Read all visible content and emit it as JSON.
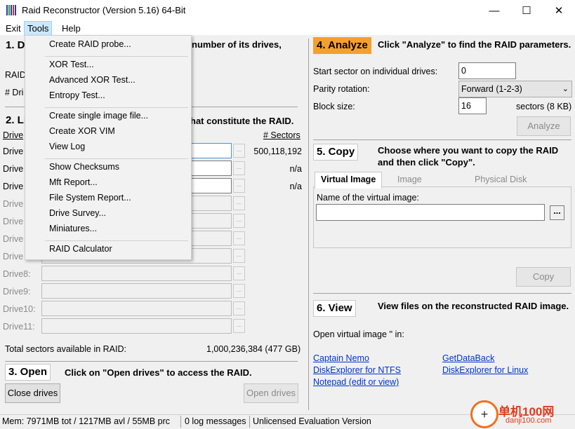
{
  "window": {
    "title": "Raid Reconstructor (Version 5.16) 64-Bit",
    "minimize": "—",
    "maximize": "☐",
    "close": "✕"
  },
  "menu": [
    "Exit",
    "Tools",
    "Help"
  ],
  "tools_menu": {
    "group1": [
      "Create RAID probe..."
    ],
    "group2": [
      "XOR Test...",
      "Advanced XOR Test...",
      "Entropy Test..."
    ],
    "group3": [
      "Create single image file...",
      "Create XOR VIM",
      "View Log"
    ],
    "group4": [
      "Show Checksums",
      "Mft Report...",
      "File System Report...",
      "Drive Survey...",
      "Miniatures..."
    ],
    "group5": [
      "RAID Calculator"
    ]
  },
  "step1": {
    "header_partial": "1. De",
    "text_partial": "number of its drives,",
    "raid_label_partial": "RAID",
    "drives_label_partial": "# Dri"
  },
  "step2": {
    "header_partial": "2. Li",
    "text_partial": "hat constitute the RAID.",
    "col_drive": "Drive",
    "col_sectors": "# Sectors",
    "drives": [
      {
        "label": "Drive",
        "sectors": "500,118,192"
      },
      {
        "label": "Drive",
        "sectors": "n/a"
      },
      {
        "label": "Drive",
        "sectors": "n/a"
      },
      {
        "label": "Drive",
        "sectors": ""
      },
      {
        "label": "Drive",
        "sectors": ""
      },
      {
        "label": "Drive",
        "sectors": ""
      },
      {
        "label": "Drive",
        "sectors": ""
      },
      {
        "label": "Drive8:",
        "sectors": ""
      },
      {
        "label": "Drive9:",
        "sectors": ""
      },
      {
        "label": "Drive10:",
        "sectors": ""
      },
      {
        "label": "Drive11:",
        "sectors": ""
      }
    ],
    "browse": "...",
    "total_label": "Total sectors available in RAID:",
    "total_value": "1,000,236,384 (477 GB)"
  },
  "step3": {
    "header": "3. Open",
    "text": "Click on \"Open drives\" to access the RAID.",
    "close_btn": "Close drives",
    "open_btn": "Open drives"
  },
  "step4": {
    "header": "4. Analyze",
    "text": "Click \"Analyze\" to find the RAID parameters.",
    "start_sector_label": "Start sector on individual drives:",
    "start_sector_value": "0",
    "parity_label": "Parity rotation:",
    "parity_value": "Forward (1-2-3)",
    "block_label": "Block size:",
    "block_value": "16",
    "block_unit": "sectors (8 KB)",
    "analyze_btn": "Analyze"
  },
  "step5": {
    "header": "5. Copy",
    "text_line1": "Choose where you want to copy the RAID",
    "text_line2": "and then click \"Copy\".",
    "tabs": [
      "Virtual Image",
      "Image",
      "Physical Disk"
    ],
    "name_label": "Name of the virtual image:",
    "name_value": "",
    "browse": "...",
    "copy_btn": "Copy"
  },
  "step6": {
    "header": "6. View",
    "text": "View files on the reconstructed RAID image.",
    "open_label": "Open virtual image '' in:",
    "links_left": [
      "Captain Nemo",
      "DiskExplorer for NTFS",
      "Notepad (edit or view)"
    ],
    "links_right": [
      "GetDataBack",
      "DiskExplorer for Linux"
    ]
  },
  "status": {
    "mem": "Mem: 7971MB tot / 1217MB avl / 55MB prc",
    "log": "0 log messages",
    "license": "Unlicensed Evaluation Version"
  },
  "watermark": {
    "site_name": "单机100网",
    "site_url": "danji100.com"
  },
  "colors": {
    "accent_orange": "#f4a030",
    "link_blue": "#0033cc",
    "menu_highlight": "#cce8ff"
  }
}
